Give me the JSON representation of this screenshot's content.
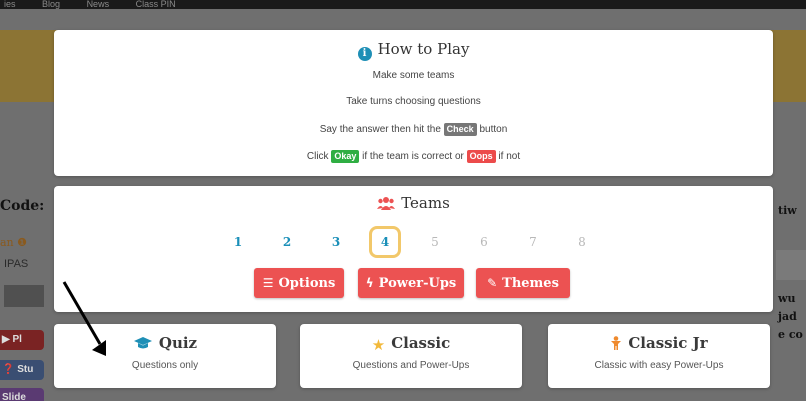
{
  "background": {
    "nav_items": [
      "ies",
      "Blog",
      "News",
      "Class PIN"
    ],
    "left_title": "Code:",
    "left_sub": "an ❶",
    "left_ipas": "IPAS",
    "left_pills": [
      "Pl",
      "Stu",
      "Slide"
    ],
    "right_top": "tiw",
    "right_lines": [
      "wu",
      "jad",
      "e co"
    ]
  },
  "how_to_play": {
    "title": "How to Play",
    "line1": "Make some teams",
    "line2": "Take turns choosing questions",
    "line3_pre": "Say the answer then hit the",
    "line3_tag": "Check",
    "line3_post": "button",
    "line4_pre": "Click",
    "line4_tag1": "Okay",
    "line4_mid": "if the team is correct or",
    "line4_tag2": "Oops",
    "line4_post": "if not"
  },
  "teams": {
    "title": "Teams",
    "numbers": [
      "1",
      "2",
      "3",
      "4",
      "5",
      "6",
      "7",
      "8"
    ],
    "selected": "4",
    "buttons": {
      "options": "Options",
      "power_ups": "Power-Ups",
      "themes": "Themes"
    }
  },
  "modes": [
    {
      "title": "Quiz",
      "subtitle": "Questions only"
    },
    {
      "title": "Classic",
      "subtitle": "Questions and Power-Ups"
    },
    {
      "title": "Classic Jr",
      "subtitle": "Classic with easy Power-Ups"
    }
  ],
  "colors": {
    "accent_blue": "#1e8fb6",
    "button_red": "#ec5252",
    "selected_border": "#f2c86a"
  }
}
